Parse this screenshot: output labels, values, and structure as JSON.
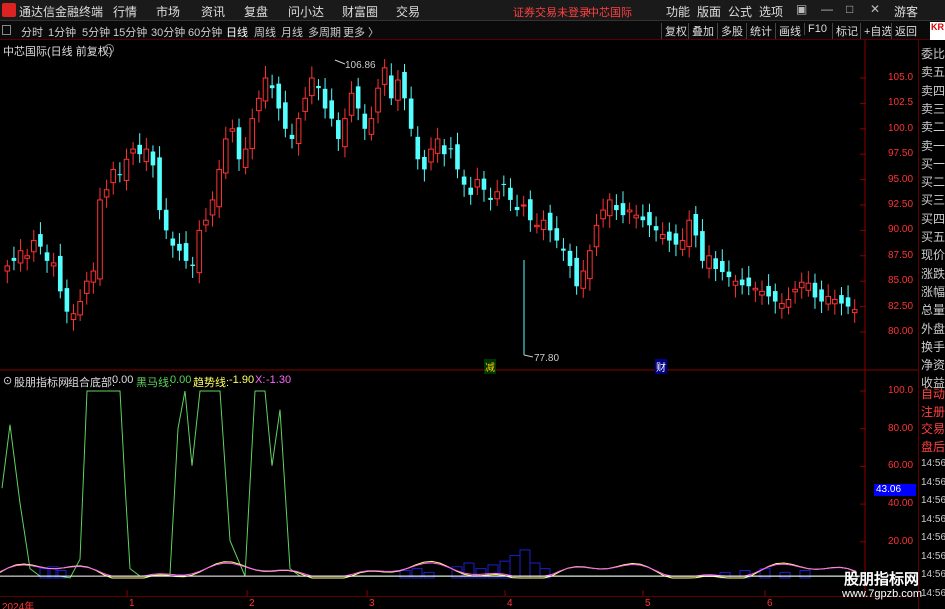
{
  "menubar": {
    "app_name": "通达信金融终端",
    "menus": [
      "行情",
      "市场",
      "资讯",
      "复盘",
      "问小达",
      "财富圈",
      "交易"
    ],
    "warning": "证券交易未登录",
    "stock_name": "中芯国际",
    "right_menus": [
      "功能",
      "版面",
      "公式",
      "选项"
    ],
    "guest": "游客"
  },
  "periodbar": {
    "periods": [
      "分时",
      "1分钟",
      "5分钟",
      "15分钟",
      "30分钟",
      "60分钟",
      "日线",
      "周线",
      "月线",
      "多周期",
      "更多"
    ],
    "active_period": "日线",
    "tools": [
      "复权",
      "叠加",
      "多股",
      "统计",
      "画线",
      "F10",
      "标记",
      "+自选",
      "返回"
    ]
  },
  "chart": {
    "title": "中芯国际(日线 前复权)",
    "high_label": "106.86",
    "low_label": "77.80",
    "price_ticks": [
      "105.0",
      "102.5",
      "100.0",
      "97.50",
      "95.00",
      "92.50",
      "90.00",
      "87.50",
      "85.00",
      "82.50",
      "80.00"
    ],
    "tag_jian": "减",
    "tag_cai": "财"
  },
  "indicator": {
    "name": "股朋指标网",
    "zhuhe_label": "组合底部:",
    "zhuhe_value": "0.00",
    "heima_label": "黑马线:",
    "heima_value": "0.00",
    "qushi_label": "趋势线:",
    "qushi_value": "-1.90",
    "x_label": "X:",
    "x_value": "-1.30",
    "ticks": [
      "100.0",
      "80.00",
      "60.00",
      "40.00",
      "20.00"
    ],
    "current_badge": "43.06"
  },
  "datebar": {
    "year": "2024年",
    "months": [
      "1",
      "2",
      "3",
      "4",
      "5",
      "6"
    ]
  },
  "sidepanel": {
    "kr_badge": "KR",
    "items": [
      "委比",
      "卖五",
      "卖四",
      "卖三",
      "卖二",
      "卖一",
      "买一",
      "买二",
      "买三",
      "买四",
      "买五",
      "现价",
      "涨跌",
      "涨幅",
      "总量",
      "外盘",
      "换手",
      "净资",
      "收益",
      "自动",
      "注册",
      "交易",
      "盘后",
      "14:56",
      "14:56",
      "14:56",
      "14:56",
      "14:56",
      "14:56",
      "14:56",
      "14:56"
    ]
  },
  "watermark": {
    "line1": "股朋指标网",
    "line2": "www.7gpzb.com"
  },
  "colors": {
    "up": "#ff3232",
    "down": "#54ffff",
    "heima": "#5fd35f",
    "qushi": "#ffff66",
    "xline": "#ff66ff",
    "volume": "#1e1ecc"
  }
}
